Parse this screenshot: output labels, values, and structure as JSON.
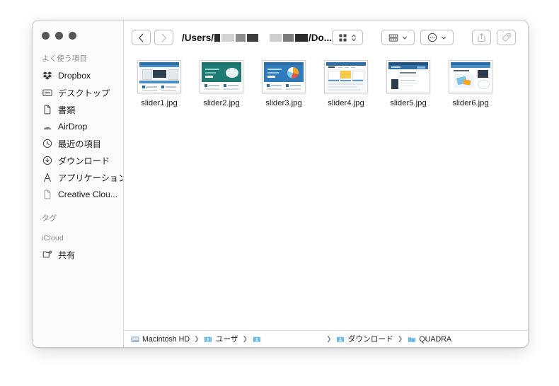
{
  "window": {
    "traffic_lights": [
      "close",
      "minimize",
      "zoom"
    ]
  },
  "sidebar": {
    "sections": [
      {
        "header": "よく使う項目",
        "items": [
          {
            "label": "Dropbox",
            "icon": "dropbox-icon"
          },
          {
            "label": "デスクトップ",
            "icon": "desktop-icon"
          },
          {
            "label": "書類",
            "icon": "document-icon"
          },
          {
            "label": "AirDrop",
            "icon": "airdrop-icon"
          },
          {
            "label": "最近の項目",
            "icon": "clock-icon"
          },
          {
            "label": "ダウンロード",
            "icon": "download-icon"
          },
          {
            "label": "アプリケーション",
            "icon": "applications-icon"
          },
          {
            "label": "Creative Clou...",
            "icon": "document-icon"
          }
        ]
      },
      {
        "header": "タグ",
        "items": []
      },
      {
        "header": "iCloud",
        "items": [
          {
            "label": "共有",
            "icon": "shared-folder-icon"
          }
        ]
      }
    ]
  },
  "toolbar": {
    "back_label": "‹",
    "forward_label": "›",
    "path_prefix": "/Users/",
    "path_suffix": "/Do...",
    "view_button": "view-switcher",
    "group_button": "group-by",
    "action_button": "action-menu",
    "share_button": "share",
    "tag_button": "tag",
    "search_button": "search"
  },
  "files": [
    {
      "name": "slider1.jpg"
    },
    {
      "name": "slider2.jpg"
    },
    {
      "name": "slider3.jpg"
    },
    {
      "name": "slider4.jpg"
    },
    {
      "name": "slider5.jpg"
    },
    {
      "name": "slider6.jpg"
    }
  ],
  "pathbar": {
    "crumbs": [
      {
        "label": "Macintosh HD",
        "icon": "harddisk-icon"
      },
      {
        "label": "ユーザ",
        "icon": "folder-user-icon"
      },
      {
        "label": "",
        "icon": "folder-user-icon"
      },
      {
        "label": "ダウンロード",
        "icon": "folder-user-icon"
      },
      {
        "label": "QUADRA",
        "icon": "folder-icon"
      }
    ]
  },
  "colors": {
    "folder_blue": "#6fb9e8",
    "accent": "#2b6cb0",
    "sidebar_bg": "#fbfbfb"
  }
}
